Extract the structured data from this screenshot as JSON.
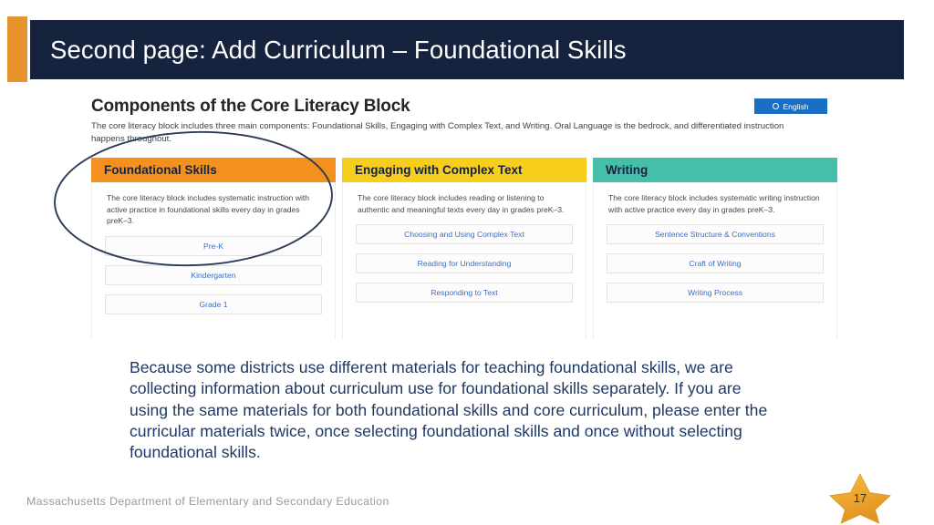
{
  "slide": {
    "title": "Second page: Add Curriculum – Foundational Skills",
    "accent_color": "#e8922b",
    "banner_color": "#16233f"
  },
  "embedded_screenshot": {
    "heading": "Components of the Core Literacy Block",
    "subtitle": "The core literacy block includes three main components: Foundational Skills, Engaging with Complex Text, and Writing. Oral Language is the bedrock, and differentiated instruction happens throughout.",
    "language_badge": {
      "label": "English",
      "icon": "circle-icon",
      "color": "#1a6fc4"
    },
    "columns": [
      {
        "title": "Foundational Skills",
        "header_color": "#f4911e",
        "description": "The core literacy block includes systematic instruction with active practice in foundational skills every day in grades preK–3.",
        "buttons": [
          "Pre-K",
          "Kindergarten",
          "Grade 1"
        ]
      },
      {
        "title": "Engaging with Complex Text",
        "header_color": "#f7ce1b",
        "description": "The core literacy block includes reading or listening to authentic and meaningful texts every day in grades preK–3.",
        "buttons": [
          "Choosing and Using Complex Text",
          "Reading for Understanding",
          "Responding to Text"
        ]
      },
      {
        "title": "Writing",
        "header_color": "#45bfa8",
        "description": "The core literacy block includes systematic writing instruction with active practice every day in grades preK–3.",
        "buttons": [
          "Sentence Structure & Conventions",
          "Craft of Writing",
          "Writing Process"
        ]
      }
    ],
    "annotation": {
      "shape": "hand-drawn-ellipse",
      "color": "#2b3a56",
      "encircles": "Foundational Skills"
    }
  },
  "body": {
    "paragraph": "Because some districts use different materials for teaching foundational skills, we are collecting information about curriculum use for foundational skills separately. If you are using the same materials for both foundational skills and core curriculum, please enter the curricular materials twice, once selecting foundational skills and once without selecting foundational skills.",
    "text_color": "#1f3864"
  },
  "footer": {
    "organization": "Massachusetts Department of Elementary and Secondary Education",
    "page_number": "17",
    "star_color": "#f0a92e"
  }
}
